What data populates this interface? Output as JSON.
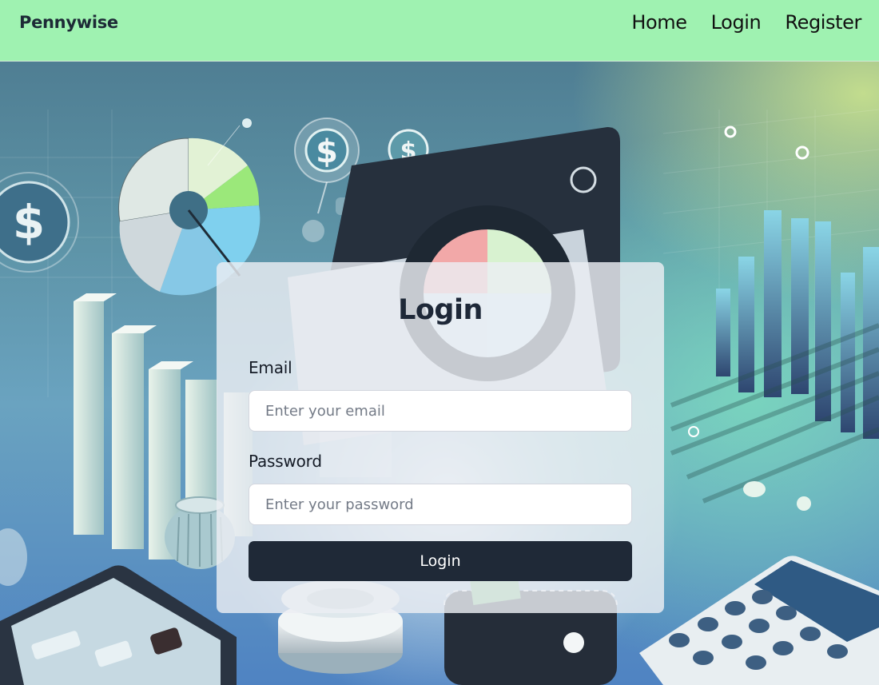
{
  "navbar": {
    "brand": "Pennywise",
    "links": [
      {
        "label": "Home"
      },
      {
        "label": "Login"
      },
      {
        "label": "Register"
      }
    ]
  },
  "login_form": {
    "title": "Login",
    "email": {
      "label": "Email",
      "placeholder": "Enter your email",
      "value": ""
    },
    "password": {
      "label": "Password",
      "placeholder": "Enter your password",
      "value": ""
    },
    "submit_label": "Login"
  },
  "background": {
    "dollar_symbol": "$",
    "colors": {
      "navbar": "#9ff2b1",
      "button": "#1f2937",
      "accent_green": "#9be87a",
      "accent_blue": "#7fd0ee",
      "accent_pink": "#f2a8a8"
    }
  }
}
